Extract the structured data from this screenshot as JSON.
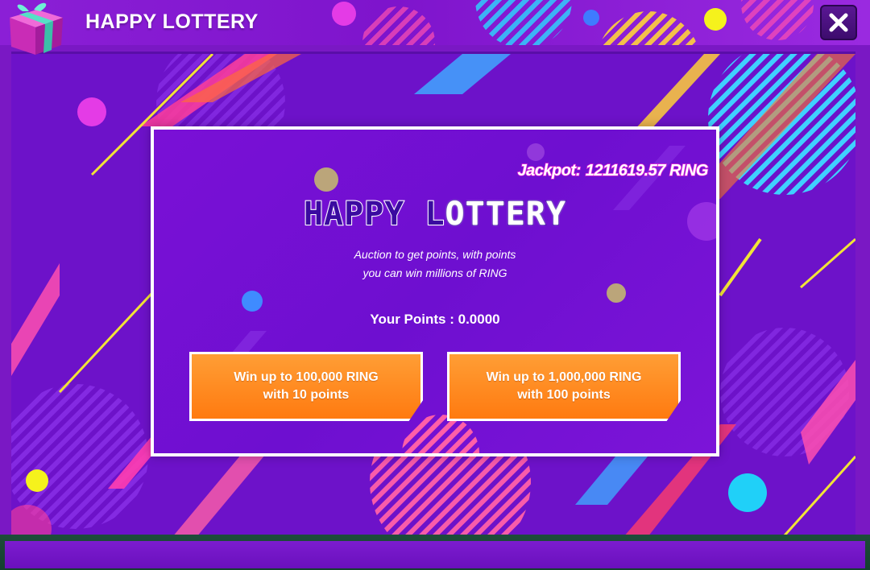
{
  "window": {
    "title": "HAPPY LOTTERY",
    "close_icon": "close-x-icon",
    "gift_icon": "gift-box-icon"
  },
  "panel": {
    "jackpot_label": "Jackpot:",
    "jackpot_value": "1211619.57 RING",
    "title_part1": "HAPPY L",
    "title_part2": "OTTERY",
    "subtitle_line1": "Auction to get points,  with points",
    "subtitle_line2": "you can win millions of RING",
    "points_label": "Your Points : 0.0000",
    "buttons": [
      {
        "line1": "Win up to 100,000 RING",
        "line2": "with 10 points"
      },
      {
        "line1": "Win up to 1,000,000 RING",
        "line2": "with 100 points"
      }
    ]
  },
  "colors": {
    "accent_purple": "#7a18c4",
    "button_orange": "#ff8a20",
    "jackpot_outline": "#e22ad8"
  }
}
